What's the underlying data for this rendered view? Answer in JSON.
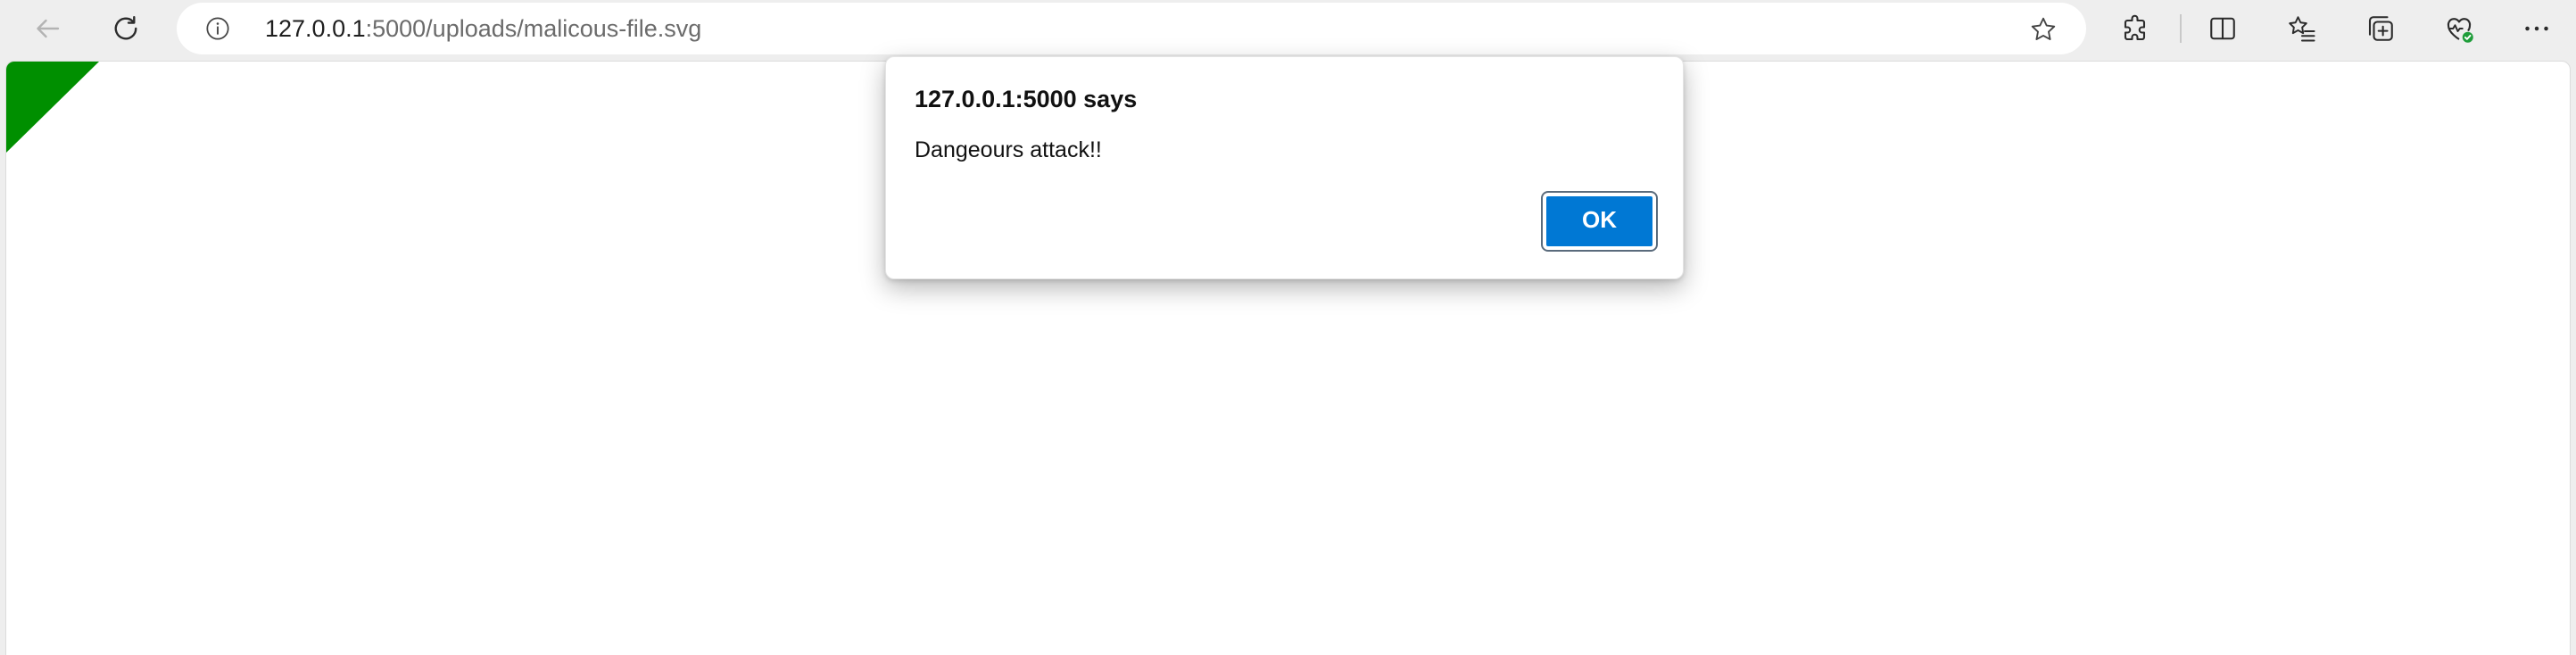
{
  "browser": {
    "url_host": "127.0.0.1",
    "url_rest": ":5000/uploads/malicous-file.svg",
    "nav": {
      "back_icon": "back-arrow-icon",
      "refresh_icon": "refresh-icon",
      "info_icon": "info-icon",
      "favorite_icon": "star-icon"
    },
    "toolbar_icons": [
      "extensions-icon",
      "split-screen-icon",
      "favorites-icon",
      "collections-icon",
      "browser-essentials-icon",
      "more-menu-icon"
    ]
  },
  "page": {
    "svg_shape_color": "#008f00"
  },
  "dialog": {
    "title": "127.0.0.1:5000 says",
    "message": "Dangeours attack!!",
    "ok_label": "OK",
    "accent_color": "#0078d4"
  }
}
